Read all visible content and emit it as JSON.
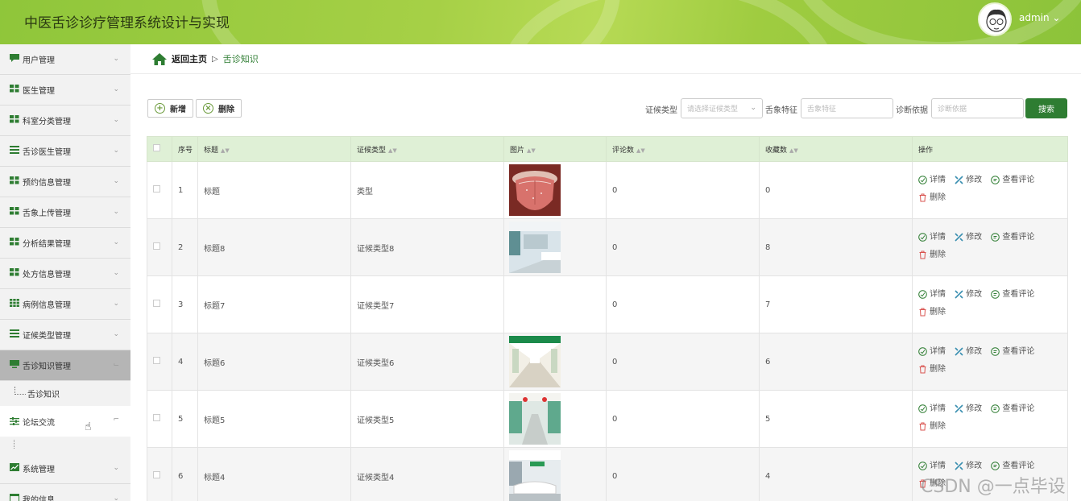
{
  "header": {
    "title": "中医舌诊诊疗管理系统设计与实现",
    "user": "admin ⌄"
  },
  "sidebar": {
    "items": [
      {
        "label": "用户管理",
        "icon": "chat-icon"
      },
      {
        "label": "医生管理",
        "icon": "grid-icon"
      },
      {
        "label": "科室分类管理",
        "icon": "grid-icon"
      },
      {
        "label": "舌诊医生管理",
        "icon": "list-icon"
      },
      {
        "label": "预约信息管理",
        "icon": "grid-icon"
      },
      {
        "label": "舌象上传管理",
        "icon": "grid-icon"
      },
      {
        "label": "分析结果管理",
        "icon": "grid-icon"
      },
      {
        "label": "处方信息管理",
        "icon": "grid-icon"
      },
      {
        "label": "病例信息管理",
        "icon": "table-icon"
      },
      {
        "label": "证候类型管理",
        "icon": "list-icon"
      },
      {
        "label": "舌诊知识管理",
        "icon": "monitor-icon"
      }
    ],
    "sub_item": "舌诊知识",
    "forum": "论坛交流",
    "bottom_items": [
      {
        "label": "系统管理",
        "icon": "chart-icon"
      },
      {
        "label": "我的信息",
        "icon": "window-icon"
      }
    ]
  },
  "breadcrumb": {
    "home": "返回主页",
    "sep": "▷",
    "current": "舌诊知识"
  },
  "toolbar": {
    "add": "新增",
    "delete": "删除"
  },
  "filters": {
    "type_label": "证候类型",
    "type_placeholder": "请选择证候类型",
    "feature_label": "舌象特征",
    "feature_placeholder": "舌象特征",
    "basis_label": "诊断依据",
    "basis_placeholder": "诊断依据",
    "search": "搜索"
  },
  "table": {
    "headers": [
      "序号",
      "标题",
      "证候类型",
      "图片",
      "评论数",
      "收藏数",
      "操作"
    ],
    "ops": {
      "detail": "详情",
      "edit": "修改",
      "comments": "查看评论",
      "delete": "删除"
    },
    "rows": [
      {
        "no": "1",
        "title": "标题",
        "type": "类型",
        "image": "tongue",
        "comments": "0",
        "favs": "0"
      },
      {
        "no": "2",
        "title": "标题8",
        "type": "证候类型8",
        "image": "hospital-hall",
        "comments": "0",
        "favs": "8"
      },
      {
        "no": "3",
        "title": "标题7",
        "type": "证候类型7",
        "image": "",
        "comments": "0",
        "favs": "7"
      },
      {
        "no": "4",
        "title": "标题6",
        "type": "证候类型6",
        "image": "hospital-corridor",
        "comments": "0",
        "favs": "6"
      },
      {
        "no": "5",
        "title": "标题5",
        "type": "证候类型5",
        "image": "hospital-lobby",
        "comments": "0",
        "favs": "5"
      },
      {
        "no": "6",
        "title": "标题4",
        "type": "证候类型4",
        "image": "reception",
        "comments": "0",
        "favs": "4"
      }
    ]
  },
  "watermark": "CSDN @一点毕设",
  "colors": {
    "header": "#9cca40",
    "primary": "#2e7d32",
    "table_head": "#dff0d6"
  }
}
